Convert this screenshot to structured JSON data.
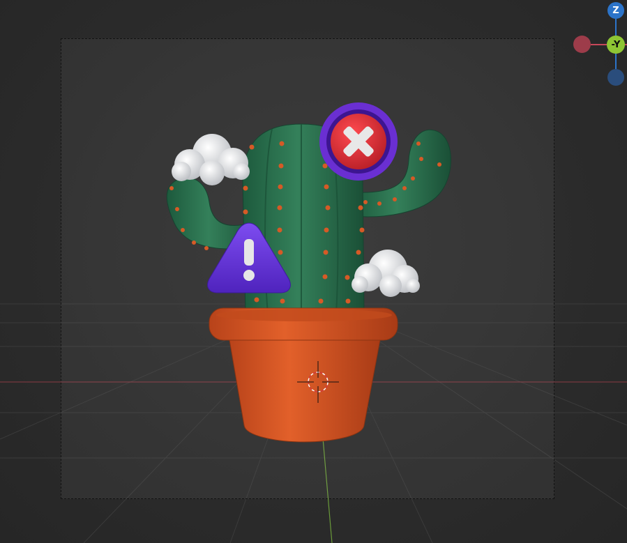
{
  "viewport": {
    "background": "#2a2a2a",
    "gizmo": {
      "z_label": "Z",
      "neg_y_label": "-Y",
      "colors": {
        "z": "#2c74c9",
        "neg_z": "#2a4d7c",
        "neg_y": "#8ec634",
        "neg_x": "#9d3c4a"
      }
    },
    "scene": {
      "objects": [
        "cactus",
        "flower-pot",
        "cloud-left",
        "cloud-right",
        "error-badge",
        "warning-badge"
      ],
      "colors": {
        "cactus": "#2f7a55",
        "pot": "#d9541e",
        "warning": "#6236d6",
        "error_ring": "#6a2fd2",
        "error_fill": "#e0313a",
        "x_axis_line": "#8a3b44",
        "y_axis_line": "#6a9a3a"
      },
      "icons": {
        "error_badge": "close-icon",
        "warning_badge": "exclamation-icon"
      }
    }
  }
}
